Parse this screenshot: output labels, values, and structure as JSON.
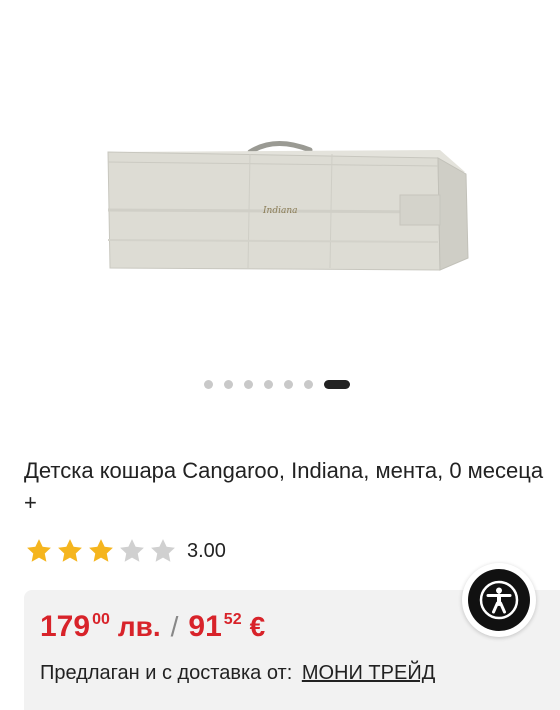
{
  "gallery": {
    "image_label": "Indiana",
    "dots_total": 7,
    "active_index": 6
  },
  "product": {
    "title": "Детска кошара Cangaroo, Indiana, мента, 0 месеца +",
    "rating": {
      "value": "3.00",
      "filled_stars": 3,
      "total_stars": 5,
      "star_color": "#f5b51e",
      "empty_color": "#d0d0d0"
    }
  },
  "price": {
    "bgn_main": "179",
    "bgn_cents": "00",
    "bgn_currency": "лв.",
    "separator": "/",
    "eur_main": "91",
    "eur_cents": "52",
    "eur_currency": "€",
    "color": "#d8232a"
  },
  "seller": {
    "label": "Предлаган и с доставка от:",
    "name": "МОНИ ТРЕЙД"
  },
  "accessibility": {
    "icon": "accessibility-icon"
  }
}
